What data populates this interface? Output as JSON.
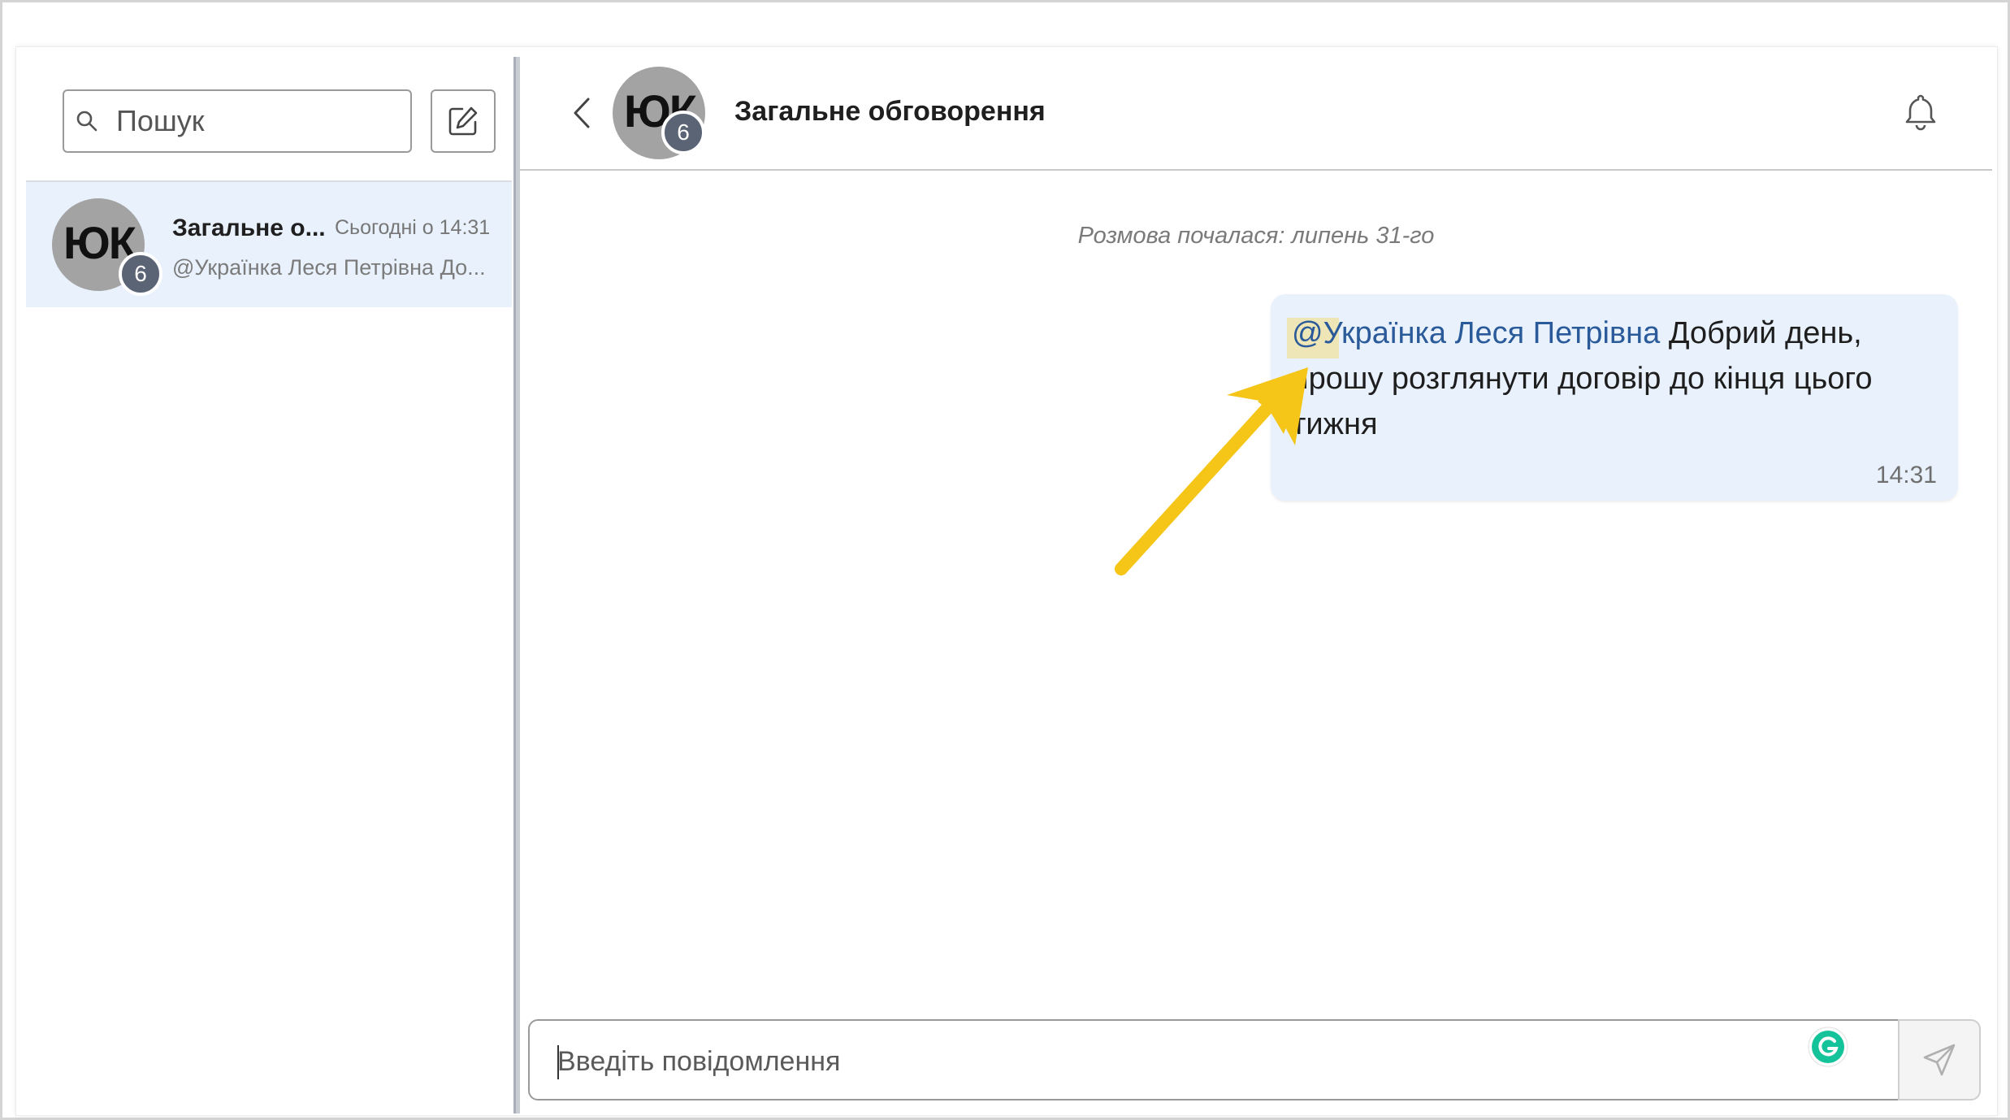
{
  "sidebar": {
    "search": {
      "placeholder": "Пошук"
    },
    "chats": [
      {
        "avatar_initials": "ЮК",
        "badge": "6",
        "title": "Загальне о...",
        "time": "Сьогодні о 14:31",
        "preview": "@Українка Леся Петрівна До..."
      }
    ]
  },
  "header": {
    "avatar_initials": "ЮК",
    "badge": "6",
    "title": "Загальне обговорення"
  },
  "conversation": {
    "started_label": "Розмова почалася: липень 31-го",
    "messages": [
      {
        "mention": "@Українка Леся Петрівна",
        "text": "Добрий день, прошу розглянути договір до кінця цього тижня",
        "time": "14:31"
      }
    ]
  },
  "composer": {
    "placeholder": "Введіть повідомлення"
  },
  "colors": {
    "accent_bg": "#e8f1fc",
    "mention": "#2a5a9a",
    "annotation_arrow": "#f5c518",
    "badge": "#5b6475"
  }
}
